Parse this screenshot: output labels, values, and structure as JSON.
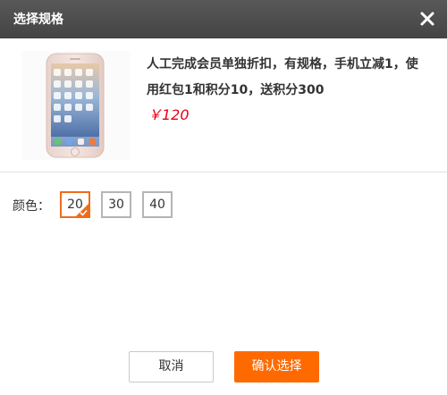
{
  "dialog": {
    "title": "选择规格",
    "close_icon": "close-icon"
  },
  "product": {
    "name": "人工完成会员单独折扣，有规格，手机立减1，使用红包1和积分10，送积分300",
    "price": "￥120",
    "image_icon": "smartphone-image"
  },
  "spec": {
    "label": "颜色：",
    "options": [
      "20",
      "30",
      "40"
    ],
    "selected": "20"
  },
  "actions": {
    "cancel": "取消",
    "confirm": "确认选择"
  },
  "colors": {
    "accent": "#ff6a00",
    "selected_border": "#ee6d1b",
    "price": "#e60012",
    "titlebar": "#4a4a4a"
  }
}
